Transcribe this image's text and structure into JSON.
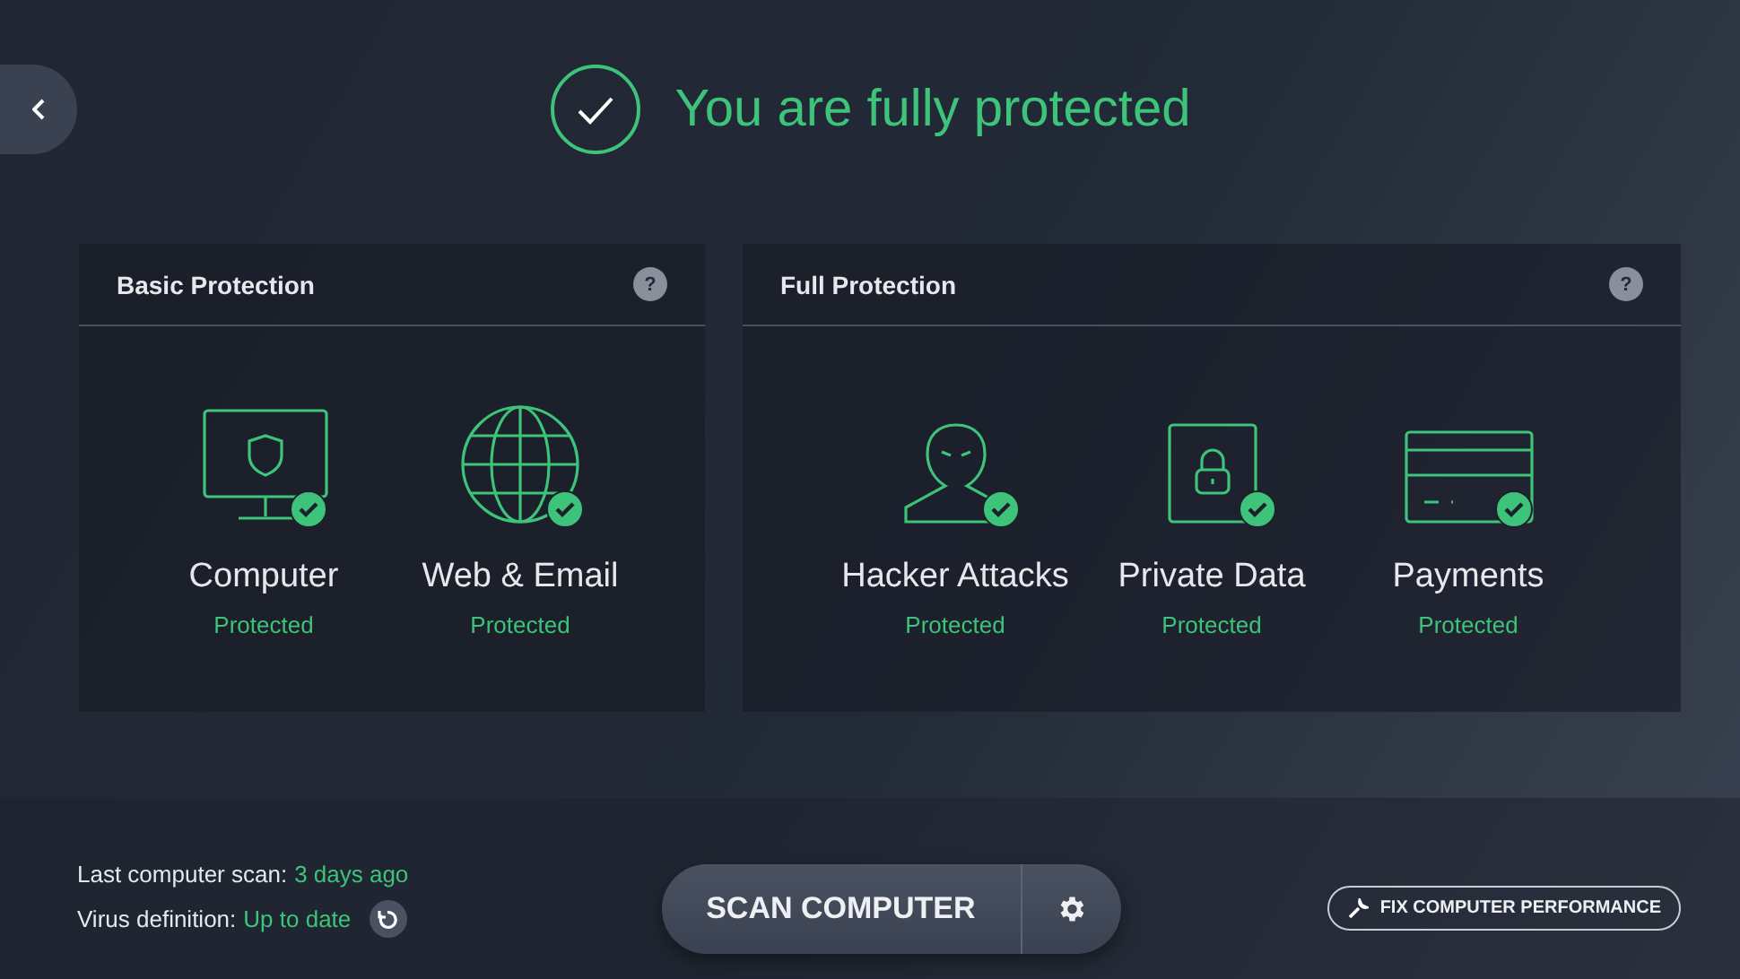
{
  "header": {
    "title": "You are fully protected"
  },
  "panels": [
    {
      "title": "Basic Protection",
      "help": "?",
      "items": [
        {
          "kind": "computer",
          "name": "Computer",
          "status": "Protected"
        },
        {
          "kind": "web",
          "name": "Web & Email",
          "status": "Protected"
        }
      ]
    },
    {
      "title": "Full Protection",
      "help": "?",
      "items": [
        {
          "kind": "hacker",
          "name": "Hacker Attacks",
          "status": "Protected"
        },
        {
          "kind": "data",
          "name": "Private Data",
          "status": "Protected"
        },
        {
          "kind": "payments",
          "name": "Payments",
          "status": "Protected"
        }
      ]
    }
  ],
  "footer": {
    "last_scan_label": "Last computer scan:",
    "last_scan_value": "3 days ago",
    "virus_label": "Virus definition:",
    "virus_value": "Up to date",
    "scan_button": "SCAN COMPUTER",
    "fix_button": "FIX COMPUTER PERFORMANCE"
  }
}
